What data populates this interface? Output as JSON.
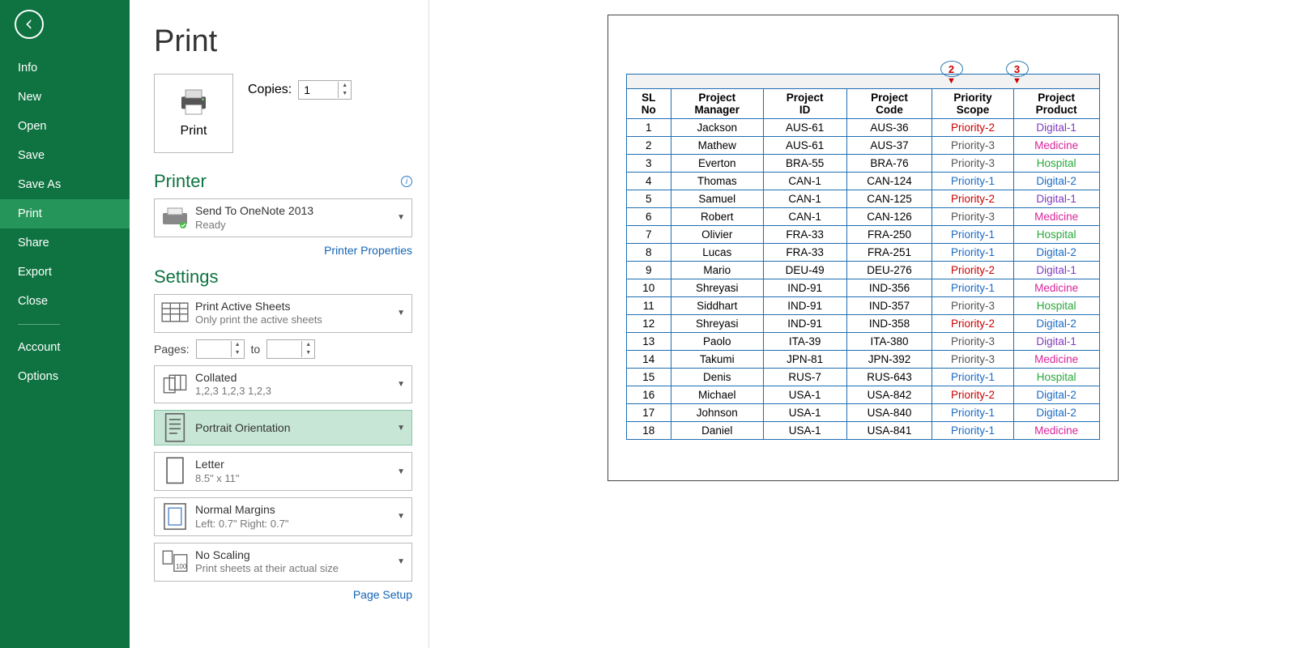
{
  "sidebar": {
    "items": [
      "Info",
      "New",
      "Open",
      "Save",
      "Save As",
      "Print",
      "Share",
      "Export",
      "Close"
    ],
    "bottom": [
      "Account",
      "Options"
    ],
    "active": "Print"
  },
  "header": {
    "title": "Print"
  },
  "print_button": {
    "label": "Print"
  },
  "copies": {
    "label": "Copies:",
    "value": "1"
  },
  "printer": {
    "section": "Printer",
    "name": "Send To OneNote 2013",
    "status": "Ready",
    "properties_link": "Printer Properties"
  },
  "settings": {
    "section": "Settings",
    "sheets": {
      "t1": "Print Active Sheets",
      "t2": "Only print the active sheets"
    },
    "pages": {
      "label": "Pages:",
      "to": "to"
    },
    "collate": {
      "t1": "Collated",
      "t2": "1,2,3    1,2,3    1,2,3"
    },
    "orientation": {
      "t1": "Portrait Orientation"
    },
    "paper": {
      "t1": "Letter",
      "t2": "8.5\" x 11\""
    },
    "margins": {
      "t1": "Normal Margins",
      "t2": "Left:  0.7\"     Right:  0.7\""
    },
    "scaling": {
      "t1": "No Scaling",
      "t2": "Print sheets at their actual size"
    },
    "page_setup_link": "Page Setup"
  },
  "annotations": {
    "a2": "2",
    "a3": "3"
  },
  "table": {
    "headers": [
      "SL No",
      "Project Manager",
      "Project ID",
      "Project Code",
      "Priority Scope",
      "Project Product"
    ],
    "rows": [
      {
        "no": "1",
        "mgr": "Jackson",
        "pid": "AUS-61",
        "code": "AUS-36",
        "prio": "Priority-2",
        "prioCls": "p-red",
        "prod": "Digital-1",
        "prodCls": "pr-purple"
      },
      {
        "no": "2",
        "mgr": "Mathew",
        "pid": "AUS-61",
        "code": "AUS-37",
        "prio": "Priority-3",
        "prioCls": "p-grey",
        "prod": "Medicine",
        "prodCls": "pr-magenta"
      },
      {
        "no": "3",
        "mgr": "Everton",
        "pid": "BRA-55",
        "code": "BRA-76",
        "prio": "Priority-3",
        "prioCls": "p-grey",
        "prod": "Hospital",
        "prodCls": "pr-green"
      },
      {
        "no": "4",
        "mgr": "Thomas",
        "pid": "CAN-1",
        "code": "CAN-124",
        "prio": "Priority-1",
        "prioCls": "p-blue",
        "prod": "Digital-2",
        "prodCls": "pr-blue"
      },
      {
        "no": "5",
        "mgr": "Samuel",
        "pid": "CAN-1",
        "code": "CAN-125",
        "prio": "Priority-2",
        "prioCls": "p-red",
        "prod": "Digital-1",
        "prodCls": "pr-purple"
      },
      {
        "no": "6",
        "mgr": "Robert",
        "pid": "CAN-1",
        "code": "CAN-126",
        "prio": "Priority-3",
        "prioCls": "p-grey",
        "prod": "Medicine",
        "prodCls": "pr-magenta"
      },
      {
        "no": "7",
        "mgr": "Olivier",
        "pid": "FRA-33",
        "code": "FRA-250",
        "prio": "Priority-1",
        "prioCls": "p-blue",
        "prod": "Hospital",
        "prodCls": "pr-green"
      },
      {
        "no": "8",
        "mgr": "Lucas",
        "pid": "FRA-33",
        "code": "FRA-251",
        "prio": "Priority-1",
        "prioCls": "p-blue",
        "prod": "Digital-2",
        "prodCls": "pr-blue"
      },
      {
        "no": "9",
        "mgr": "Mario",
        "pid": "DEU-49",
        "code": "DEU-276",
        "prio": "Priority-2",
        "prioCls": "p-red",
        "prod": "Digital-1",
        "prodCls": "pr-purple"
      },
      {
        "no": "10",
        "mgr": "Shreyasi",
        "pid": "IND-91",
        "code": "IND-356",
        "prio": "Priority-1",
        "prioCls": "p-blue",
        "prod": "Medicine",
        "prodCls": "pr-magenta"
      },
      {
        "no": "11",
        "mgr": "Siddhart",
        "pid": "IND-91",
        "code": "IND-357",
        "prio": "Priority-3",
        "prioCls": "p-grey",
        "prod": "Hospital",
        "prodCls": "pr-green"
      },
      {
        "no": "12",
        "mgr": "Shreyasi",
        "pid": "IND-91",
        "code": "IND-358",
        "prio": "Priority-2",
        "prioCls": "p-red",
        "prod": "Digital-2",
        "prodCls": "pr-blue"
      },
      {
        "no": "13",
        "mgr": "Paolo",
        "pid": "ITA-39",
        "code": "ITA-380",
        "prio": "Priority-3",
        "prioCls": "p-grey",
        "prod": "Digital-1",
        "prodCls": "pr-purple"
      },
      {
        "no": "14",
        "mgr": "Takumi",
        "pid": "JPN-81",
        "code": "JPN-392",
        "prio": "Priority-3",
        "prioCls": "p-grey",
        "prod": "Medicine",
        "prodCls": "pr-magenta"
      },
      {
        "no": "15",
        "mgr": "Denis",
        "pid": "RUS-7",
        "code": "RUS-643",
        "prio": "Priority-1",
        "prioCls": "p-blue",
        "prod": "Hospital",
        "prodCls": "pr-green"
      },
      {
        "no": "16",
        "mgr": "Michael",
        "pid": "USA-1",
        "code": "USA-842",
        "prio": "Priority-2",
        "prioCls": "p-red",
        "prod": "Digital-2",
        "prodCls": "pr-blue"
      },
      {
        "no": "17",
        "mgr": "Johnson",
        "pid": "USA-1",
        "code": "USA-840",
        "prio": "Priority-1",
        "prioCls": "p-blue",
        "prod": "Digital-2",
        "prodCls": "pr-blue"
      },
      {
        "no": "18",
        "mgr": "Daniel",
        "pid": "USA-1",
        "code": "USA-841",
        "prio": "Priority-1",
        "prioCls": "p-blue",
        "prod": "Medicine",
        "prodCls": "pr-magenta"
      }
    ]
  }
}
